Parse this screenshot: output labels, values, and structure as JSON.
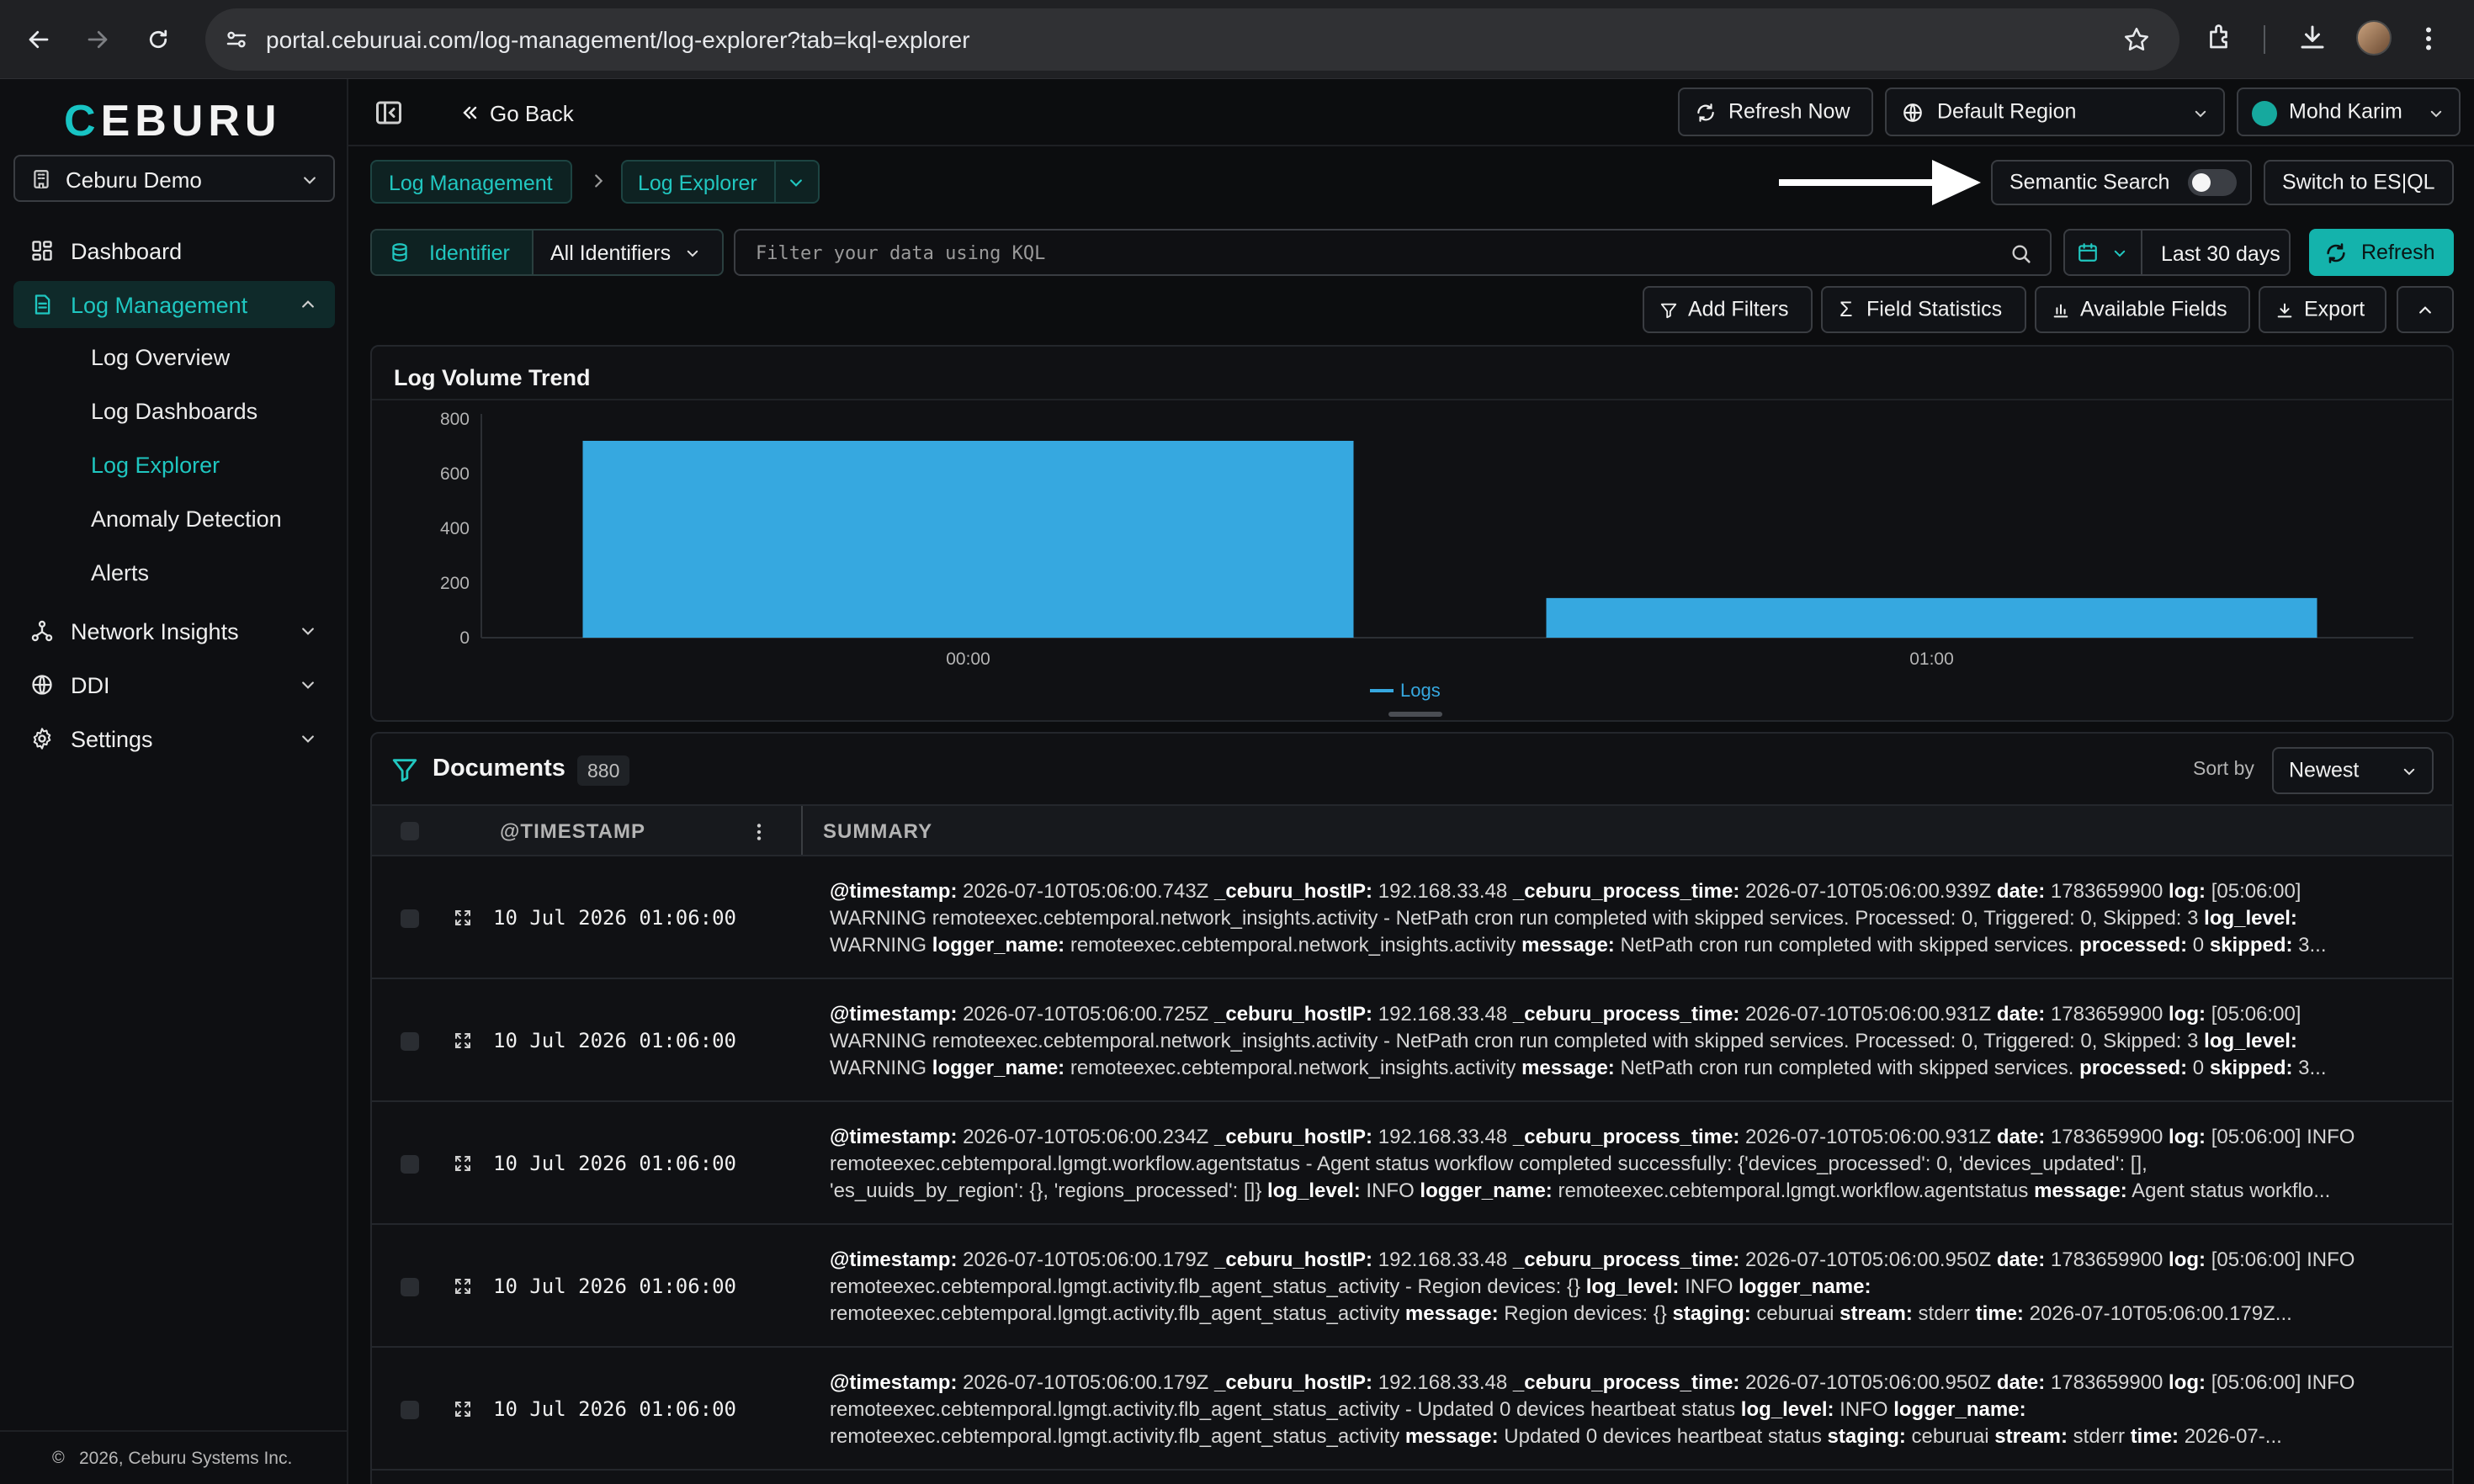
{
  "browser": {
    "url": "portal.ceburuai.com/log-management/log-explorer?tab=kql-explorer"
  },
  "sidebar": {
    "logo": "CEBURU",
    "org": "Ceburu Demo",
    "items": [
      {
        "label": "Dashboard"
      },
      {
        "label": "Log Management"
      },
      {
        "label": "Network Insights"
      },
      {
        "label": "DDI"
      },
      {
        "label": "Settings"
      }
    ],
    "sub_items": [
      {
        "label": "Log Overview"
      },
      {
        "label": "Log Dashboards"
      },
      {
        "label": "Log Explorer"
      },
      {
        "label": "Anomaly Detection"
      },
      {
        "label": "Alerts"
      }
    ],
    "footer": "2026, Ceburu Systems Inc."
  },
  "topbar": {
    "go_back": "Go Back",
    "refresh_now": "Refresh Now",
    "region": "Default Region",
    "user": "Mohd Karim"
  },
  "breadcrumb": {
    "parent": "Log Management",
    "current": "Log Explorer"
  },
  "toolbar": {
    "semantic_search": "Semantic Search",
    "switch_esql": "Switch to ES|QL",
    "identifier": "Identifier",
    "all_identifiers": "All Identifiers",
    "search_placeholder": "Filter your data using KQL",
    "time_range": "Last 30 days",
    "refresh": "Refresh",
    "add_filters": "Add Filters",
    "field_statistics": "Field Statistics",
    "available_fields": "Available Fields",
    "export": "Export"
  },
  "chart_data": {
    "type": "bar",
    "title": "Log Volume Trend",
    "categories": [
      "00:00",
      "01:00"
    ],
    "series": [
      {
        "name": "Logs",
        "values": [
          720,
          145
        ]
      }
    ],
    "ylim": [
      0,
      800
    ],
    "yticks": [
      "800",
      "600",
      "400",
      "200",
      "0"
    ],
    "color": "#36a8e0"
  },
  "documents": {
    "title": "Documents",
    "count": "880",
    "sort_label": "Sort by",
    "sort_value": "Newest",
    "col_timestamp": "@TIMESTAMP",
    "col_summary": "SUMMARY",
    "rows": [
      {
        "ts": "10 Jul 2026 01:06:00",
        "l1": [
          [
            "@timestamp:",
            " 2026-07-10T05:06:00.743Z "
          ],
          [
            "_ceburu_hostIP:",
            " 192.168.33.48 "
          ],
          [
            "_ceburu_process_time:",
            " 2026-07-10T05:06:00.939Z "
          ],
          [
            "date:",
            " 1783659900 "
          ],
          [
            "log:",
            " [05:06:00]"
          ]
        ],
        "l2": [
          [
            "",
            "WARNING remoteexec.cebtemporal.network_insights.activity - NetPath cron run completed with skipped services. Processed: 0, Triggered: 0, Skipped: 3 "
          ],
          [
            "log_level:",
            ""
          ]
        ],
        "l3": [
          [
            "",
            "WARNING "
          ],
          [
            "logger_name:",
            " remoteexec.cebtemporal.network_insights.activity "
          ],
          [
            "message:",
            " NetPath cron run completed with skipped services. "
          ],
          [
            "processed:",
            " 0 "
          ],
          [
            "skipped:",
            " 3..."
          ]
        ]
      },
      {
        "ts": "10 Jul 2026 01:06:00",
        "l1": [
          [
            "@timestamp:",
            " 2026-07-10T05:06:00.725Z "
          ],
          [
            "_ceburu_hostIP:",
            " 192.168.33.48 "
          ],
          [
            "_ceburu_process_time:",
            " 2026-07-10T05:06:00.931Z "
          ],
          [
            "date:",
            " 1783659900 "
          ],
          [
            "log:",
            " [05:06:00]"
          ]
        ],
        "l2": [
          [
            "",
            "WARNING remoteexec.cebtemporal.network_insights.activity - NetPath cron run completed with skipped services. Processed: 0, Triggered: 0, Skipped: 3 "
          ],
          [
            "log_level:",
            ""
          ]
        ],
        "l3": [
          [
            "",
            "WARNING "
          ],
          [
            "logger_name:",
            " remoteexec.cebtemporal.network_insights.activity "
          ],
          [
            "message:",
            " NetPath cron run completed with skipped services. "
          ],
          [
            "processed:",
            " 0 "
          ],
          [
            "skipped:",
            " 3..."
          ]
        ]
      },
      {
        "ts": "10 Jul 2026 01:06:00",
        "l1": [
          [
            "@timestamp:",
            " 2026-07-10T05:06:00.234Z "
          ],
          [
            "_ceburu_hostIP:",
            " 192.168.33.48 "
          ],
          [
            "_ceburu_process_time:",
            " 2026-07-10T05:06:00.931Z "
          ],
          [
            "date:",
            " 1783659900 "
          ],
          [
            "log:",
            " [05:06:00] INFO"
          ]
        ],
        "l2": [
          [
            "",
            "remoteexec.cebtemporal.lgmgt.workflow.agentstatus - Agent status workflow completed successfully: {'devices_processed': 0, 'devices_updated': [],"
          ]
        ],
        "l3": [
          [
            "",
            "'es_uuids_by_region': {}, 'regions_processed': []} "
          ],
          [
            "log_level:",
            " INFO "
          ],
          [
            "logger_name:",
            " remoteexec.cebtemporal.lgmgt.workflow.agentstatus "
          ],
          [
            "message:",
            " Agent status workflo..."
          ]
        ]
      },
      {
        "ts": "10 Jul 2026 01:06:00",
        "l1": [
          [
            "@timestamp:",
            " 2026-07-10T05:06:00.179Z "
          ],
          [
            "_ceburu_hostIP:",
            " 192.168.33.48 "
          ],
          [
            "_ceburu_process_time:",
            " 2026-07-10T05:06:00.950Z "
          ],
          [
            "date:",
            " 1783659900 "
          ],
          [
            "log:",
            " [05:06:00] INFO"
          ]
        ],
        "l2": [
          [
            "",
            "remoteexec.cebtemporal.lgmgt.activity.flb_agent_status_activity - Region devices: {} "
          ],
          [
            "log_level:",
            " INFO "
          ],
          [
            "logger_name:",
            ""
          ]
        ],
        "l3": [
          [
            "",
            "remoteexec.cebtemporal.lgmgt.activity.flb_agent_status_activity "
          ],
          [
            "message:",
            " Region devices: {} "
          ],
          [
            "staging:",
            " ceburuai "
          ],
          [
            "stream:",
            " stderr "
          ],
          [
            "time:",
            " 2026-07-10T05:06:00.179Z..."
          ]
        ]
      },
      {
        "ts": "10 Jul 2026 01:06:00",
        "l1": [
          [
            "@timestamp:",
            " 2026-07-10T05:06:00.179Z "
          ],
          [
            "_ceburu_hostIP:",
            " 192.168.33.48 "
          ],
          [
            "_ceburu_process_time:",
            " 2026-07-10T05:06:00.950Z "
          ],
          [
            "date:",
            " 1783659900 "
          ],
          [
            "log:",
            " [05:06:00] INFO"
          ]
        ],
        "l2": [
          [
            "",
            "remoteexec.cebtemporal.lgmgt.activity.flb_agent_status_activity - Updated 0 devices heartbeat status "
          ],
          [
            "log_level:",
            " INFO "
          ],
          [
            "logger_name:",
            ""
          ]
        ],
        "l3": [
          [
            "",
            "remoteexec.cebtemporal.lgmgt.activity.flb_agent_status_activity "
          ],
          [
            "message:",
            " Updated 0 devices heartbeat status "
          ],
          [
            "staging:",
            " ceburuai "
          ],
          [
            "stream:",
            " stderr "
          ],
          [
            "time:",
            " 2026-07-..."
          ]
        ]
      }
    ]
  }
}
